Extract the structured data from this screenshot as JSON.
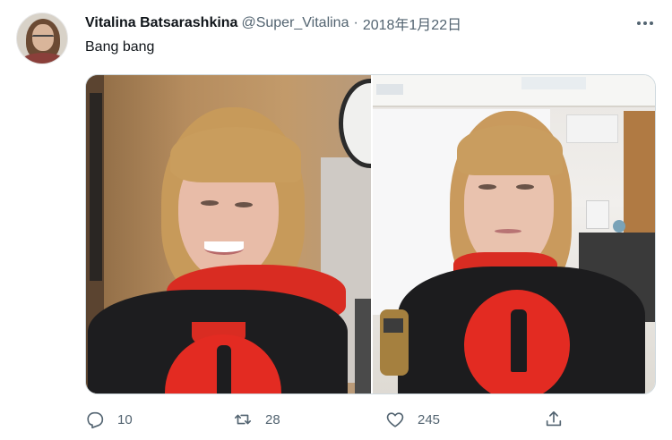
{
  "tweet": {
    "author": {
      "display_name": "Vitalina Batsarashkina",
      "handle": "@Super_Vitalina",
      "separator": "·",
      "date": "2018年1月22日"
    },
    "text": "Bang bang",
    "media": {
      "count": 2,
      "photos": [
        "photo-left",
        "photo-right"
      ]
    },
    "actions": {
      "reply": {
        "icon": "reply-icon",
        "count": "10"
      },
      "retweet": {
        "icon": "retweet-icon",
        "count": "28"
      },
      "like": {
        "icon": "heart-icon",
        "count": "245"
      },
      "share": {
        "icon": "share-icon"
      }
    },
    "more_icon": "more-icon"
  },
  "colors": {
    "text_primary": "#0f1419",
    "text_secondary": "#536471",
    "border": "#cfd9de"
  }
}
